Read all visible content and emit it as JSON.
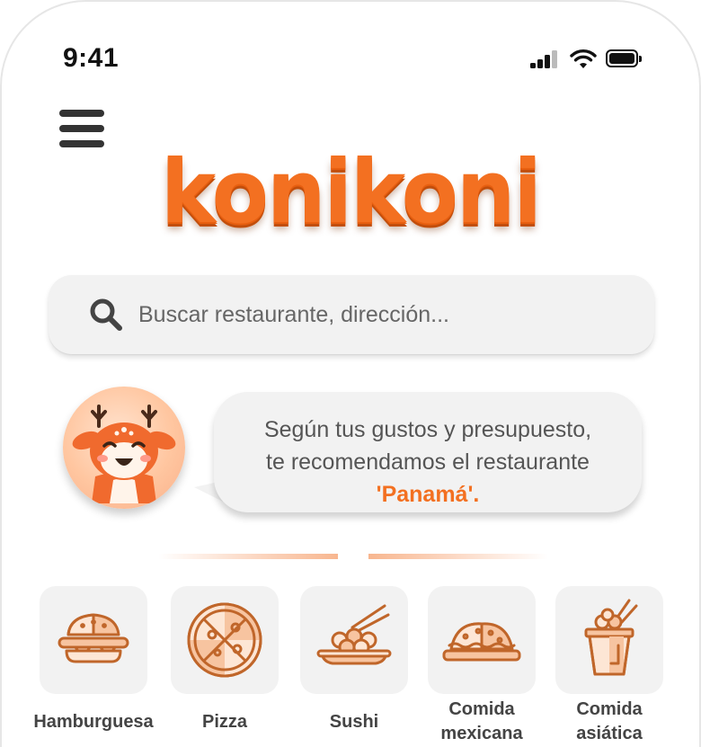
{
  "status_bar": {
    "time": "9:41"
  },
  "logo": {
    "text": "konikoni"
  },
  "search": {
    "placeholder": "Buscar restaurante, dirección..."
  },
  "recommendation": {
    "line1": "Según tus gustos y presupuesto,",
    "line2": "te recomendamos el restaurante",
    "restaurant": "'Panamá'."
  },
  "categories": [
    {
      "label": "Hamburguesa",
      "icon": "burger-icon"
    },
    {
      "label": "Pizza",
      "icon": "pizza-icon"
    },
    {
      "label": "Sushi",
      "icon": "sushi-icon"
    },
    {
      "label_line1": "Comida",
      "label_line2": "mexicana",
      "icon": "taco-icon"
    },
    {
      "label_line1": "Comida",
      "label_line2": "asiática",
      "icon": "noodles-box-icon"
    }
  ],
  "colors": {
    "brand": "#f37021",
    "icon_stroke": "#c0662a",
    "icon_fill": "#f7c4a0",
    "tile_bg": "#f2f2f2"
  }
}
